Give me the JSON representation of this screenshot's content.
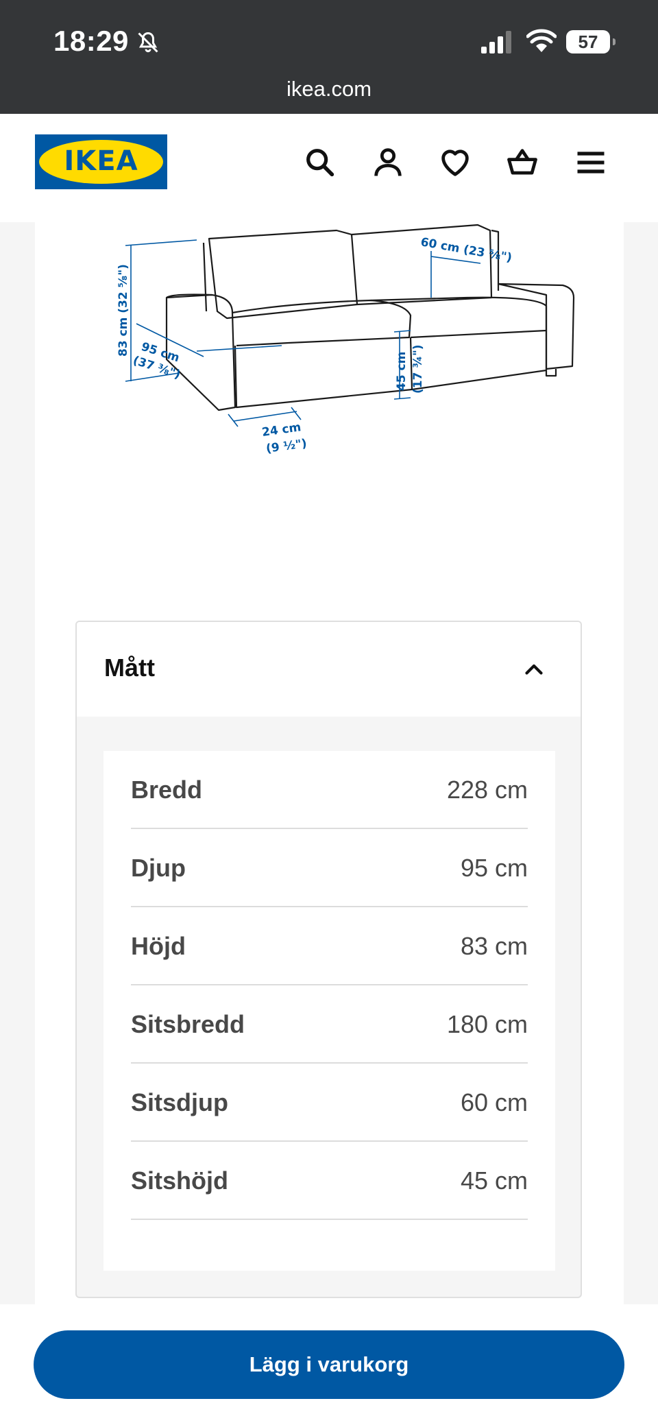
{
  "status_bar": {
    "time": "18:29",
    "battery": "57",
    "icons": [
      "bell-muted-icon",
      "cellular-signal-icon",
      "wifi-icon",
      "battery-icon"
    ]
  },
  "browser": {
    "url": "ikea.com"
  },
  "header": {
    "logo_text": "IKEA",
    "icons": [
      "search-icon",
      "account-icon",
      "heart-icon",
      "basket-icon",
      "menu-icon"
    ]
  },
  "illustration": {
    "labels": {
      "height": "83 cm (32 ⅝\")",
      "depth_cm": "95 cm",
      "depth_in": "(37 ⅜\")",
      "arm_cm": "24 cm",
      "arm_in": "(9 ½\")",
      "seat_depth": "60 cm (23 ⅝\")",
      "seat_height_cm": "45 cm",
      "seat_height_in": "(17 ¾\")"
    }
  },
  "dimensions": {
    "title": "Mått",
    "rows": [
      {
        "label": "Bredd",
        "value": "228 cm"
      },
      {
        "label": "Djup",
        "value": "95 cm"
      },
      {
        "label": "Höjd",
        "value": "83 cm"
      },
      {
        "label": "Sitsbredd",
        "value": "180 cm"
      },
      {
        "label": "Sitsdjup",
        "value": "60 cm"
      },
      {
        "label": "Sitshöjd",
        "value": "45 cm"
      }
    ]
  },
  "cta": {
    "label": "Lägg i varukorg"
  },
  "colors": {
    "brand_blue": "#0058a3",
    "brand_yellow": "#ffdb00",
    "dimension_blue": "#0058a3",
    "status_bar": "#343638"
  }
}
